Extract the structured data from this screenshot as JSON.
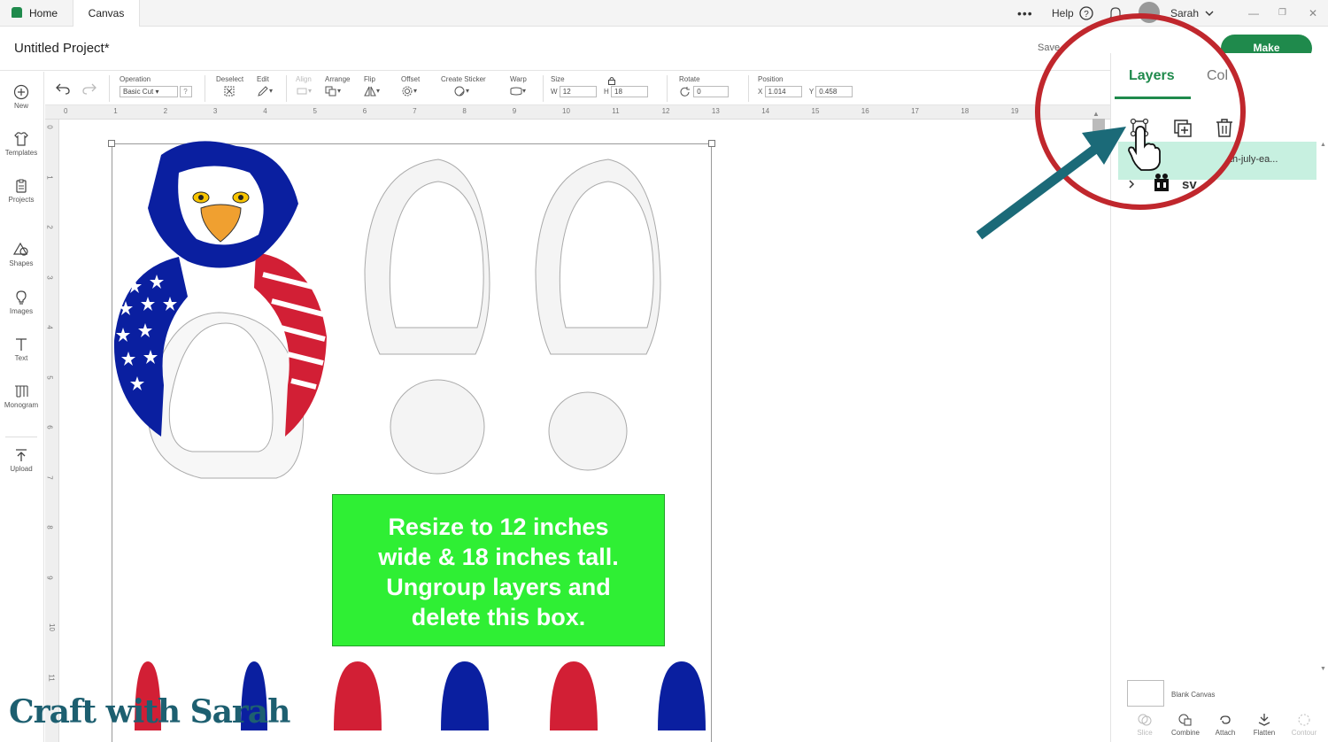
{
  "tabs": {
    "home": "Home",
    "canvas": "Canvas"
  },
  "topbar": {
    "help": "Help",
    "user": "Sarah",
    "more": "•••"
  },
  "header": {
    "project_title": "Untitled Project*",
    "save": "Save",
    "make": "Make"
  },
  "sidebar": [
    {
      "label": "New",
      "icon": "plus-circle-icon"
    },
    {
      "label": "Templates",
      "icon": "shirt-icon"
    },
    {
      "label": "Projects",
      "icon": "clipboard-icon"
    },
    {
      "label": "Shapes",
      "icon": "shapes-icon"
    },
    {
      "label": "Images",
      "icon": "lightbulb-icon"
    },
    {
      "label": "Text",
      "icon": "text-icon"
    },
    {
      "label": "Monogram",
      "icon": "monogram-icon"
    },
    {
      "label": "Upload",
      "icon": "upload-icon"
    }
  ],
  "toolbar": {
    "operation_label": "Operation",
    "operation_value": "Basic Cut",
    "deselect": "Deselect",
    "edit": "Edit",
    "align": "Align",
    "arrange": "Arrange",
    "flip": "Flip",
    "offset": "Offset",
    "create_sticker": "Create Sticker",
    "warp": "Warp",
    "size": "Size",
    "size_w_label": "W",
    "size_w": "12",
    "size_h_label": "H",
    "size_h": "18",
    "rotate": "Rotate",
    "rotate_value": "0",
    "position": "Position",
    "pos_x_label": "X",
    "pos_x": "1.014",
    "pos_y_label": "Y",
    "pos_y": "0.458"
  },
  "ruler_top": [
    "0",
    "1",
    "2",
    "3",
    "4",
    "5",
    "6",
    "7",
    "8",
    "9",
    "10",
    "11",
    "12",
    "13",
    "14",
    "15",
    "16",
    "17",
    "18",
    "19"
  ],
  "ruler_left": [
    "0",
    "1",
    "2",
    "3",
    "4",
    "5",
    "6",
    "7",
    "8",
    "9",
    "10",
    "11"
  ],
  "canvas": {
    "instruction_lines": [
      "Resize to 12 inches",
      "wide & 18 inches tall.",
      "Ungroup layers and",
      "delete this box."
    ],
    "watermark": "Craft with Sarah"
  },
  "right_panel": {
    "tab_layers": "Layers",
    "tab_color": "Col",
    "layer_name": "th-july-ea...",
    "layer_sub": "sv",
    "blank_canvas": "Blank Canvas",
    "bottom_tools": [
      "Slice",
      "Combine",
      "Attach",
      "Flatten",
      "Contour"
    ]
  },
  "colors": {
    "brand_green": "#1f8a4c",
    "instruction_green": "#2fef34",
    "highlight_circle": "#c0272d",
    "arrow": "#1b6a78",
    "layer_selected": "#c7f0e0",
    "eagle_blue": "#0a1fa0",
    "eagle_red": "#d21f35"
  }
}
